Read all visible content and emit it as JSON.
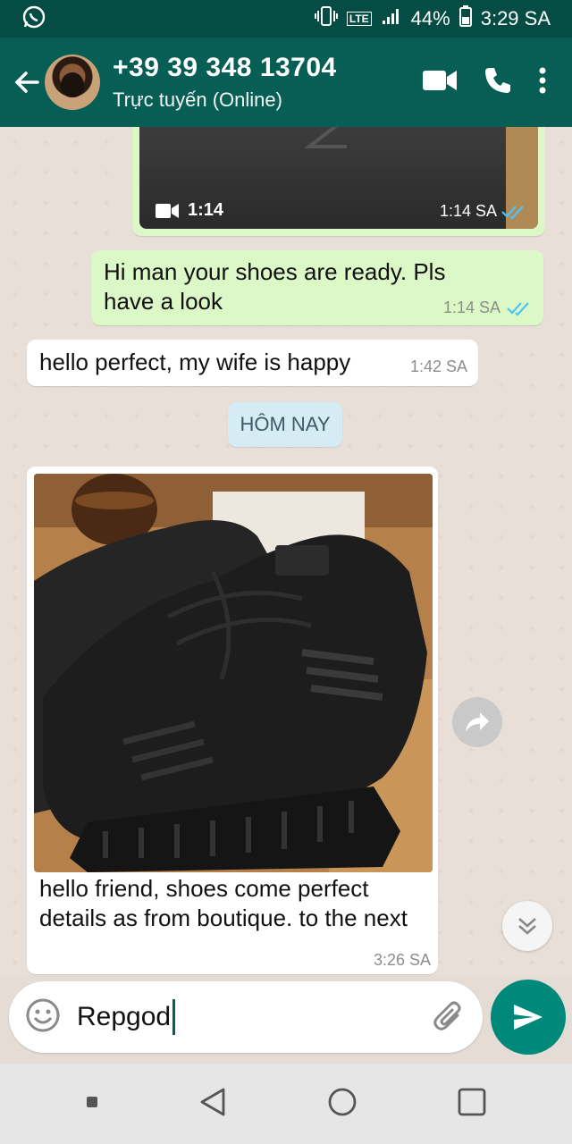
{
  "status_bar": {
    "battery": "44%",
    "time": "3:29 SA",
    "network": "LTE"
  },
  "header": {
    "contact_name": "+39 39 348 13704",
    "status": "Trực tuyến (Online)"
  },
  "messages": {
    "video": {
      "duration": "1:14",
      "time": "1:14 SA"
    },
    "out_text": {
      "text": "Hi man your shoes are ready. Pls have a look",
      "time": "1:14 SA"
    },
    "in_text": {
      "text": "hello perfect, my wife is happy",
      "time": "1:42 SA"
    },
    "date_separator": "HÔM NAY",
    "image_caption": {
      "text": "hello friend, shoes come perfect details as from boutique.  to the next",
      "time": "3:26 SA"
    }
  },
  "composer": {
    "value": "Repgod"
  },
  "colors": {
    "header": "#075e54",
    "status_bar": "#054d44",
    "outgoing_bubble": "#dcf8c6",
    "incoming_bubble": "#ffffff",
    "send_button": "#00897b",
    "read_tick": "#4fc3f7"
  }
}
